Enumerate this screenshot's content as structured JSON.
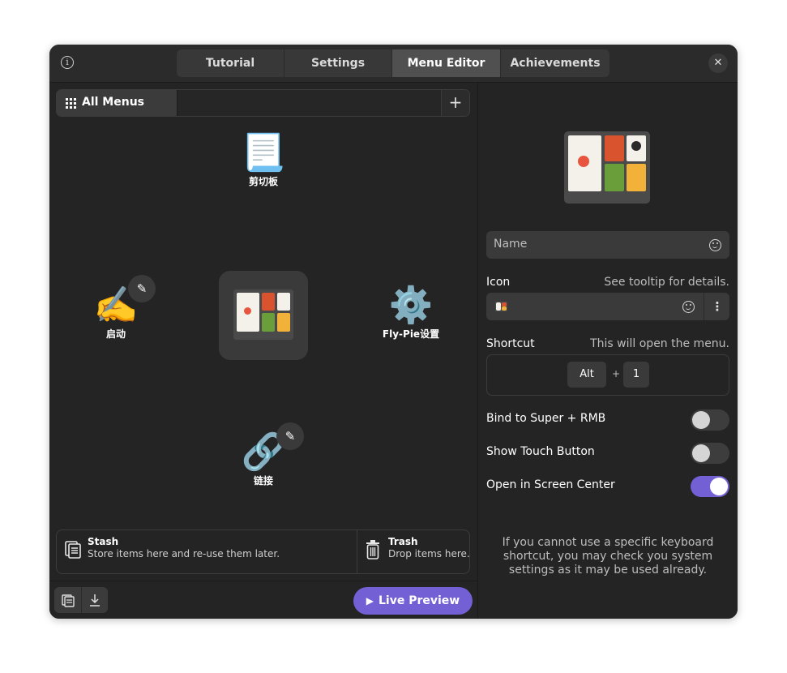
{
  "header": {
    "tabs": [
      {
        "label": "Tutorial",
        "active": false
      },
      {
        "label": "Settings",
        "active": false
      },
      {
        "label": "Menu Editor",
        "active": true
      },
      {
        "label": "Achievements",
        "active": false
      }
    ],
    "info_icon": "info-icon",
    "close_icon": "close-icon"
  },
  "menus_bar": {
    "all_menus_label": "All Menus",
    "add_icon": "plus-icon"
  },
  "menu_items": {
    "top": {
      "label": "剪切板",
      "icon": "📃"
    },
    "left": {
      "label": "启动",
      "icon": "✍️"
    },
    "right": {
      "label": "Fly-Pie设置",
      "icon": "⚙️"
    },
    "bottom": {
      "label": "链接",
      "icon": "🔗"
    },
    "center": {
      "icon": "bento-box"
    }
  },
  "stash": {
    "title": "Stash",
    "subtitle": "Store items here and re-use them later."
  },
  "trash": {
    "title": "Trash",
    "subtitle": "Drop items here."
  },
  "footer": {
    "live_preview_label": "Live Preview"
  },
  "properties": {
    "name_placeholder": "Name",
    "icon_label": "Icon",
    "icon_hint": "See tooltip for details.",
    "shortcut_label": "Shortcut",
    "shortcut_hint": "This will open the menu.",
    "shortcut_keys": [
      "Alt",
      "1"
    ],
    "shortcut_plus": "+",
    "toggles": [
      {
        "label": "Bind to Super + RMB",
        "on": false
      },
      {
        "label": "Show Touch Button",
        "on": false
      },
      {
        "label": "Open in Screen Center",
        "on": true
      }
    ],
    "help_text": "If you cannot use a specific keyboard shortcut, you may check you system settings as it may be used already."
  },
  "colors": {
    "accent": "#7360d4",
    "window_bg": "#242424",
    "header_bg": "#2b2b2b"
  }
}
